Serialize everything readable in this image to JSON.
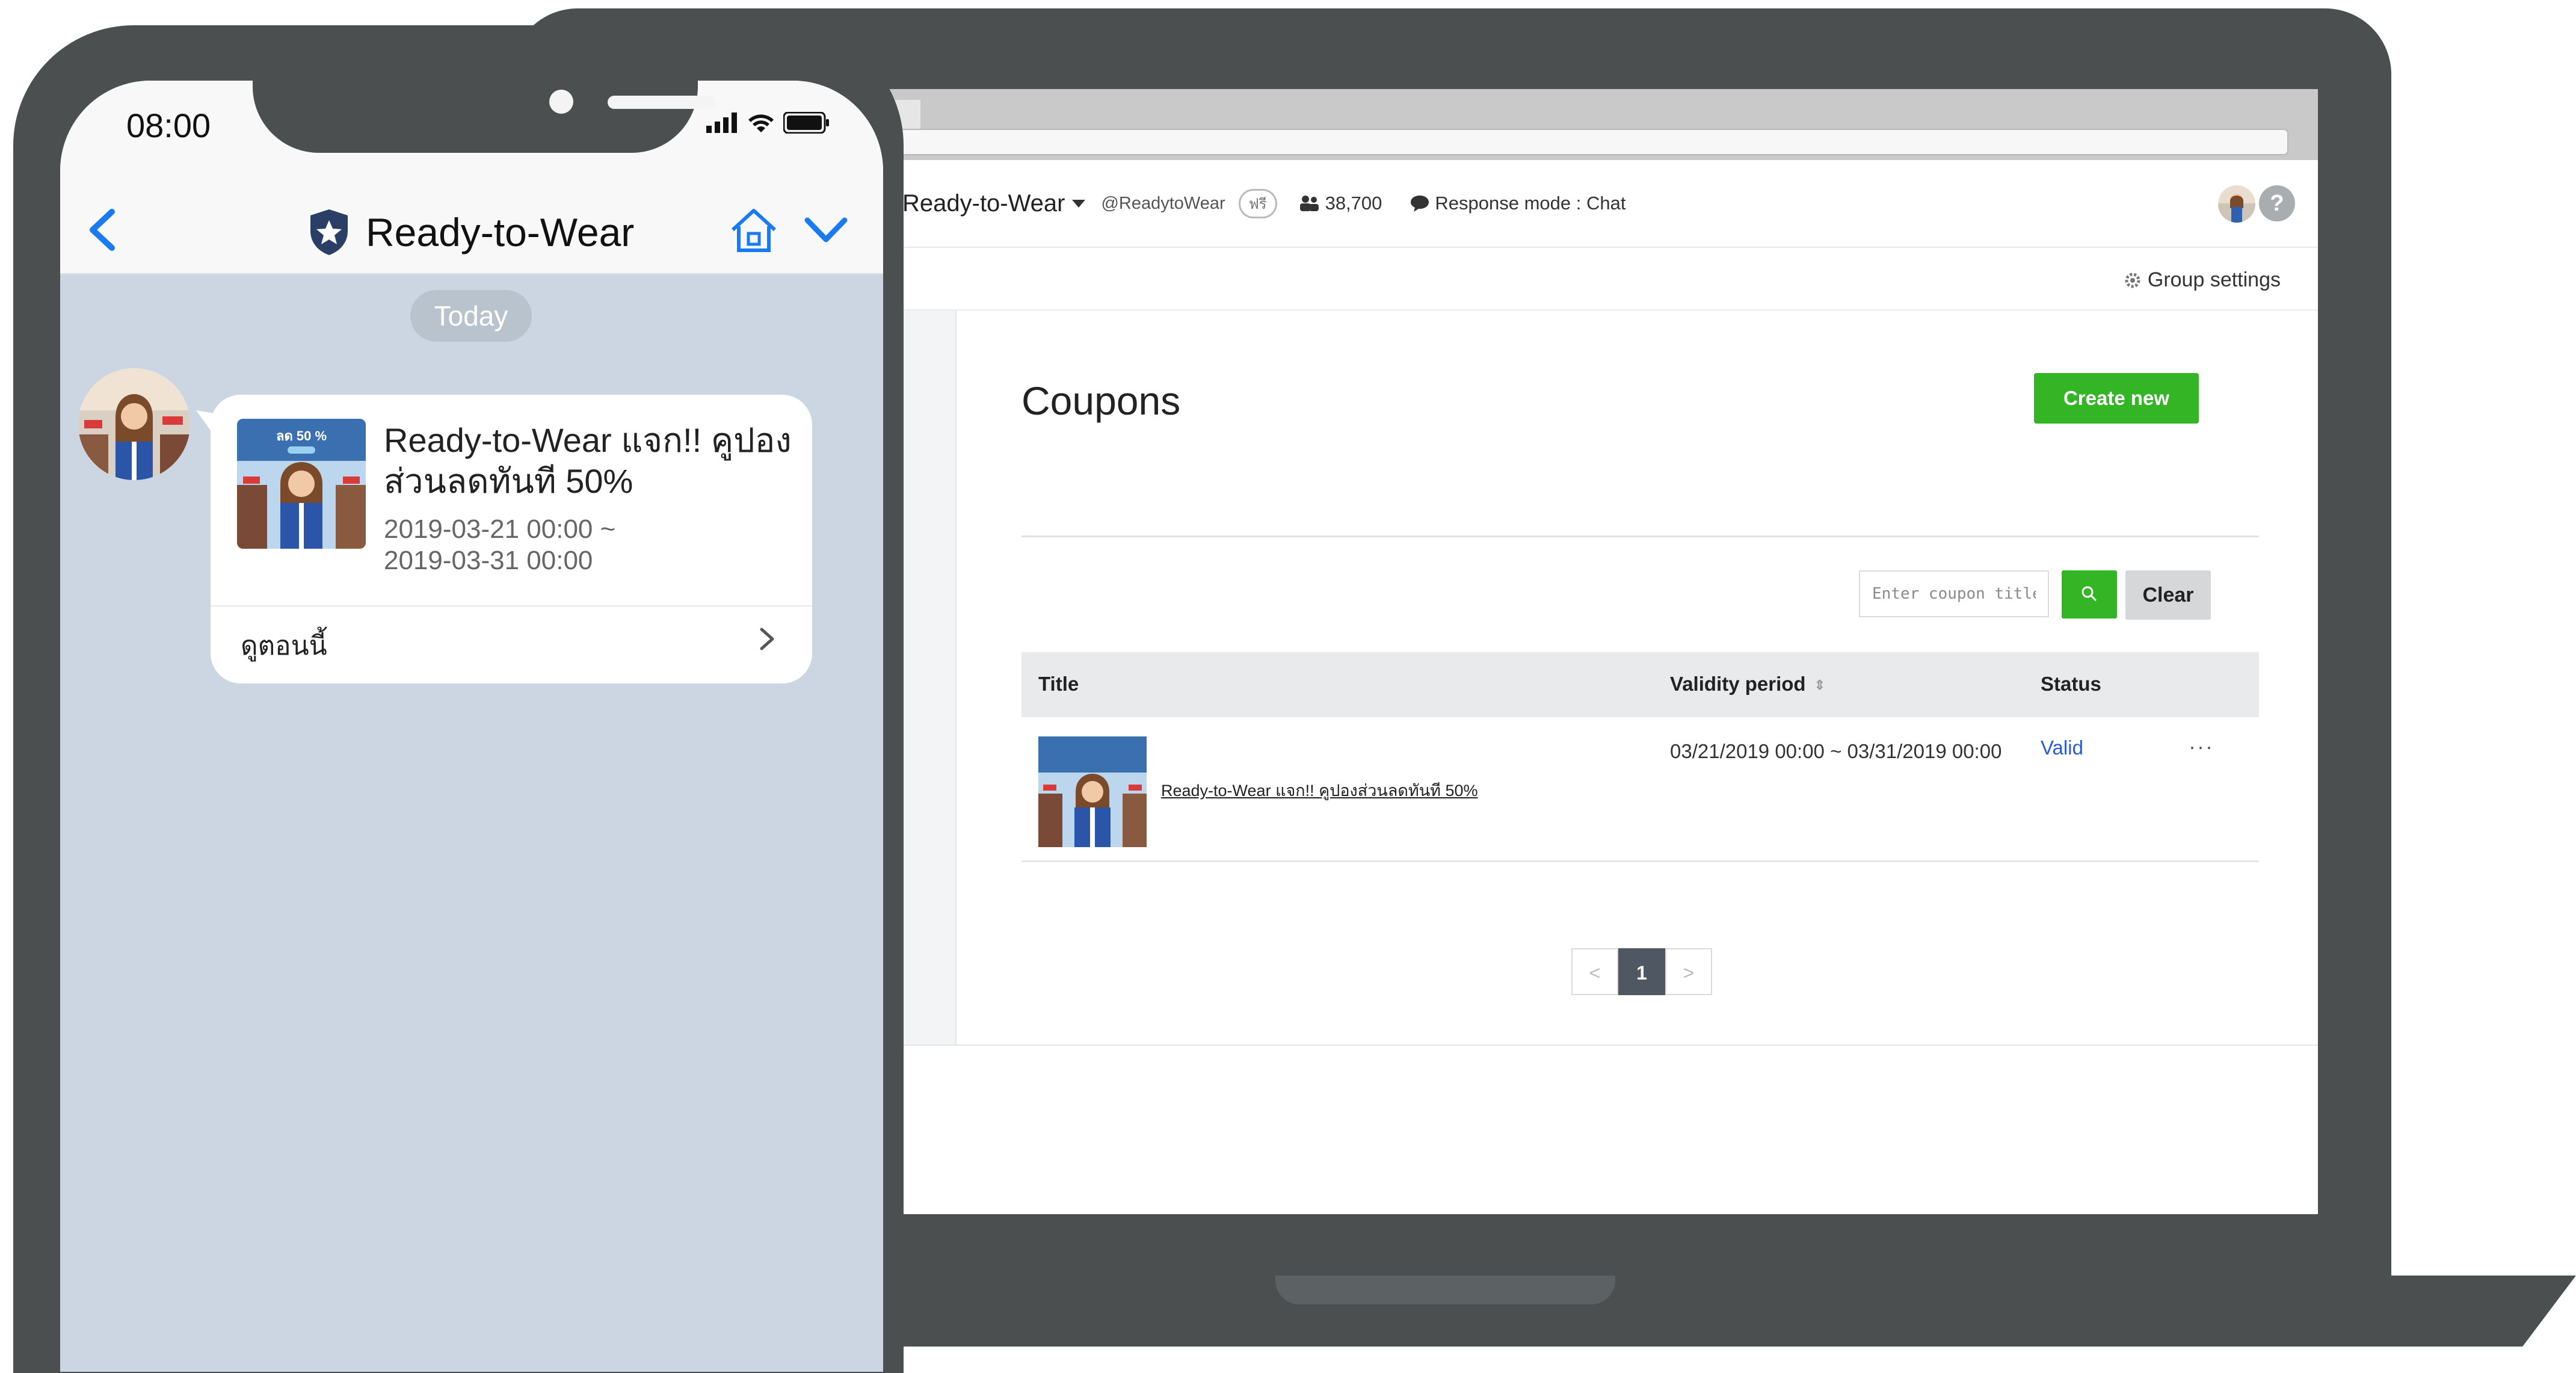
{
  "laptop": {
    "header": {
      "account_name": "Ready-to-Wear",
      "handle": "@ReadytoWear",
      "plan_badge": "ฟรี",
      "friends_count": "38,700",
      "response_mode": "Response mode : Chat"
    },
    "subbar": {
      "group_settings": "Group settings"
    },
    "page": {
      "title": "Coupons",
      "create_button": "Create new",
      "search_placeholder": "Enter coupon title",
      "clear_button": "Clear"
    },
    "table": {
      "columns": {
        "title": "Title",
        "validity": "Validity period",
        "status": "Status"
      },
      "rows": [
        {
          "title": "Ready-to-Wear แจก!! คูปองส่วนลดทันที 50%",
          "validity": "03/21/2019 00:00 ~ 03/31/2019 00:00",
          "status": "Valid",
          "more": "···"
        }
      ]
    },
    "pagination": {
      "prev": "<",
      "current": "1",
      "next": ">"
    }
  },
  "phone": {
    "status_bar": {
      "time": "08:00"
    },
    "nav": {
      "title": "Ready-to-Wear"
    },
    "date_pill": "Today",
    "message": {
      "thumb_badge": "ลด 50 %",
      "title": "Ready-to-Wear แจก!! คูปองส่วนลดทันที 50%",
      "date_start": "2019-03-21 00:00 ~",
      "date_end": "2019-03-31 00:00",
      "link": "ดูตอนนี้"
    }
  },
  "colors": {
    "accent_green": "#34b526",
    "device_gray": "#4b4f50",
    "chat_background": "#cbd6e2",
    "link_blue": "#2a5bd7",
    "ios_blue": "#1a7bf0"
  },
  "icons": [
    "caret-down-icon",
    "friends-icon",
    "chat-bubble-icon",
    "gear-icon",
    "help-icon",
    "search-icon",
    "sort-icon",
    "signal-icon",
    "wifi-icon",
    "battery-icon",
    "back-chevron-icon",
    "shield-star-icon",
    "home-icon",
    "chevron-down-icon",
    "chevron-right-icon"
  ]
}
